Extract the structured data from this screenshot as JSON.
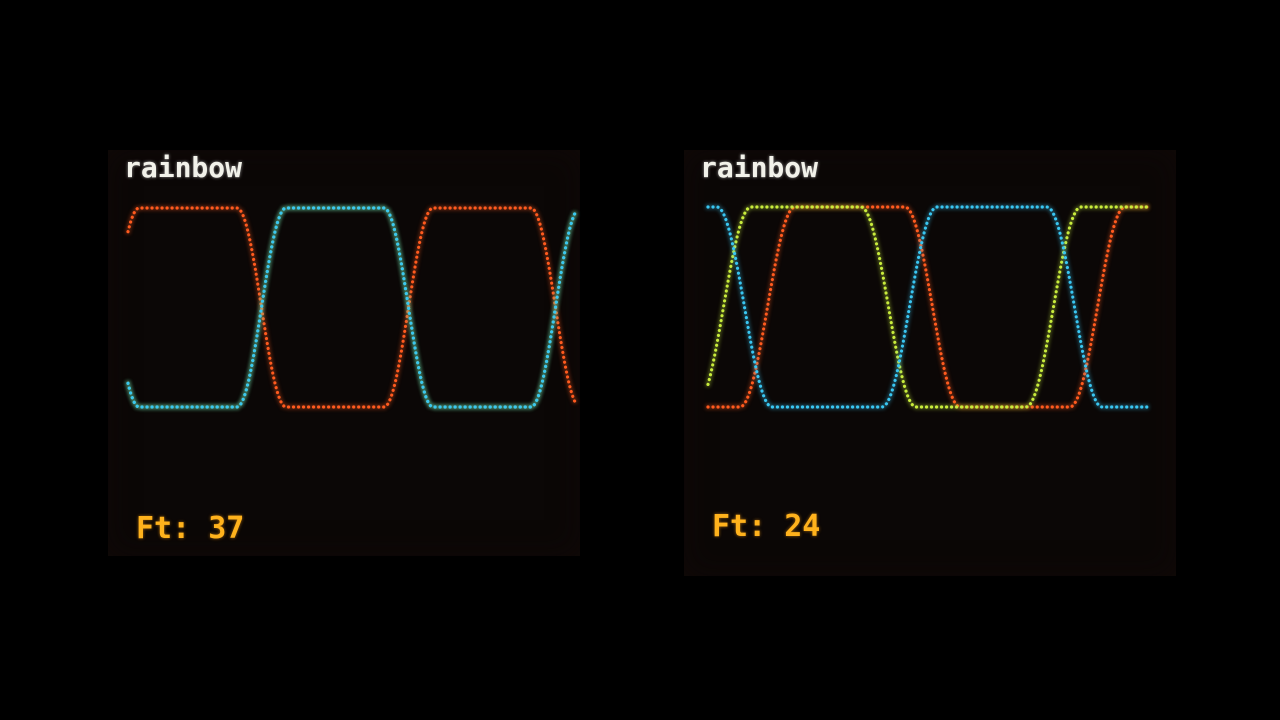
{
  "screens": [
    {
      "title": "rainbow",
      "ft_label": "Ft:",
      "ft_value": "37",
      "curves": [
        {
          "name": "red",
          "color": "#ff5a1e",
          "phase": 0.0
        },
        {
          "name": "green",
          "color": "#a6e84a",
          "phase": 0.0
        },
        {
          "name": "blue",
          "color": "#39c6f2",
          "phase": 0.0
        }
      ]
    },
    {
      "title": "rainbow",
      "ft_label": "Ft:",
      "ft_value": "24",
      "curves": [
        {
          "name": "red",
          "color": "#ff5a1e",
          "phase": 0.0
        },
        {
          "name": "green",
          "color": "#c8ec3c",
          "phase": 0.0
        },
        {
          "name": "blue",
          "color": "#39c6f2",
          "phase": 0.0
        }
      ]
    }
  ],
  "colors": {
    "background": "#000000",
    "screen": "#0b0706",
    "title": "#f2f2ea",
    "readout": "#ffb21c"
  }
}
